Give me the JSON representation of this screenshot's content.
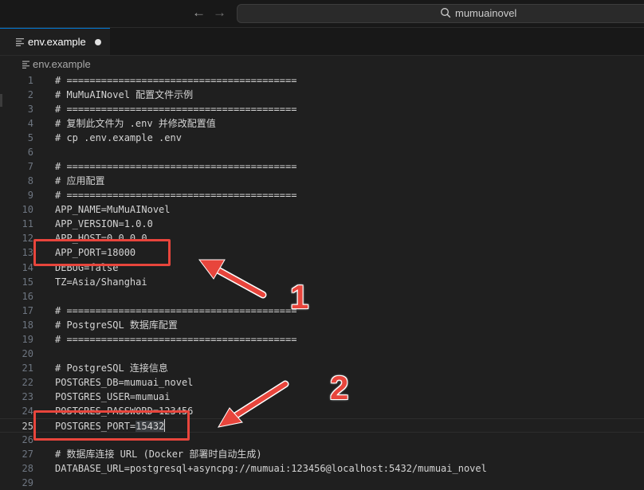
{
  "titlebar": {
    "back_icon": "arrow-left-icon",
    "forward_icon": "arrow-right-icon",
    "search_icon": "search-icon",
    "search_text": "mumuainovel"
  },
  "tab": {
    "label": "env.example",
    "icon": "lines-file-icon",
    "modified": true
  },
  "breadcrumb": {
    "label": "env.example",
    "icon": "lines-file-icon"
  },
  "editor": {
    "current_line": 25,
    "selected_text": "15432",
    "lines": [
      {
        "n": "1",
        "text": "# ========================================"
      },
      {
        "n": "2",
        "text": "# MuMuAINovel 配置文件示例"
      },
      {
        "n": "3",
        "text": "# ========================================"
      },
      {
        "n": "4",
        "text": "# 复制此文件为 .env 并修改配置值"
      },
      {
        "n": "5",
        "text": "# cp .env.example .env"
      },
      {
        "n": "6",
        "text": ""
      },
      {
        "n": "7",
        "text": "# ========================================"
      },
      {
        "n": "8",
        "text": "# 应用配置"
      },
      {
        "n": "9",
        "text": "# ========================================"
      },
      {
        "n": "10",
        "text": "APP_NAME=MuMuAINovel"
      },
      {
        "n": "11",
        "text": "APP_VERSION=1.0.0"
      },
      {
        "n": "12",
        "text": "APP_HOST=0.0.0.0"
      },
      {
        "n": "13",
        "text": "APP_PORT=18000"
      },
      {
        "n": "14",
        "text": "DEBUG=false"
      },
      {
        "n": "15",
        "text": "TZ=Asia/Shanghai"
      },
      {
        "n": "16",
        "text": ""
      },
      {
        "n": "17",
        "text": "# ========================================"
      },
      {
        "n": "18",
        "text": "# PostgreSQL 数据库配置"
      },
      {
        "n": "19",
        "text": "# ========================================"
      },
      {
        "n": "20",
        "text": ""
      },
      {
        "n": "21",
        "text": "# PostgreSQL 连接信息"
      },
      {
        "n": "22",
        "text": "POSTGRES_DB=mumuai_novel"
      },
      {
        "n": "23",
        "text": "POSTGRES_USER=mumuai"
      },
      {
        "n": "24",
        "text": "POSTGRES_PASSWORD=123456"
      },
      {
        "n": "25",
        "text": "POSTGRES_PORT=",
        "selected": "15432"
      },
      {
        "n": "26",
        "text": ""
      },
      {
        "n": "27",
        "text": "# 数据库连接 URL (Docker 部署时自动生成)"
      },
      {
        "n": "28",
        "text": "DATABASE_URL=postgresql+asyncpg://mumuai:123456@localhost:5432/mumuai_novel"
      },
      {
        "n": "29",
        "text": ""
      }
    ]
  },
  "annotations": {
    "label_1": "1",
    "label_2": "2",
    "color": "#e8453c"
  }
}
